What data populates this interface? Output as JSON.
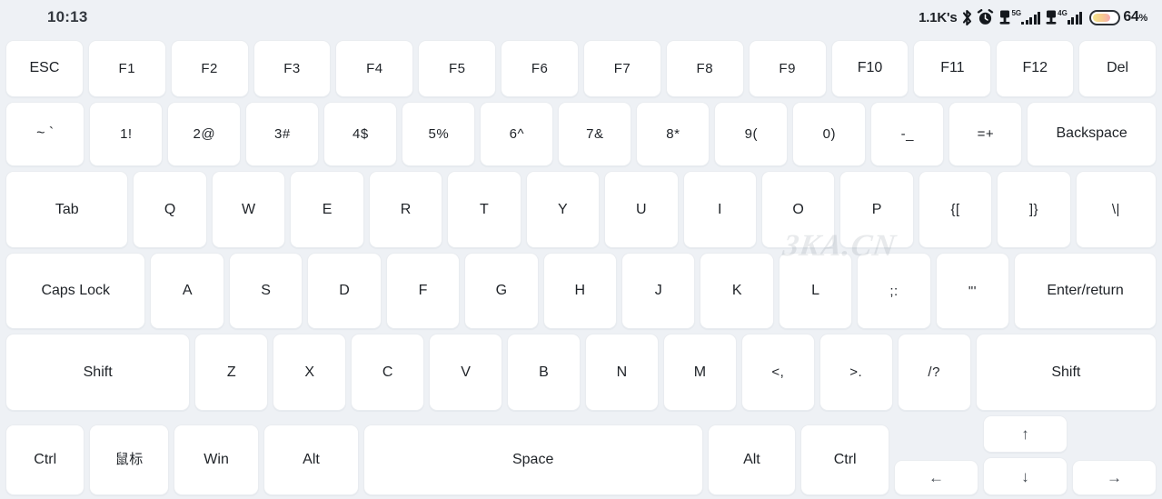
{
  "statusbar": {
    "time": "10:13",
    "network_speed": "1.1K's",
    "icons": [
      "bluetooth-icon",
      "alarm-clock-icon",
      "sim-card-icon",
      "sim-card-icon"
    ],
    "sim1_generation": "5G",
    "sim2_generation": "4G",
    "sim1_bars": 4,
    "sim2_bars": 4,
    "battery_percent": "64",
    "battery_percent_symbol": "%",
    "battery_level": 64
  },
  "watermark": "3KA.CN",
  "colors": {
    "background": "#eef1f5",
    "key_face": "#ffffff",
    "key_border": "#e9ecf0",
    "key_text": "#1e2227",
    "status_text": "#1b1f24",
    "battery_gradient_start": "#f3e48a",
    "battery_gradient_end": "#f4a9b3"
  },
  "keyboard": {
    "rows": [
      {
        "name": "function-row",
        "keys": [
          {
            "label": "ESC",
            "name": "key-esc",
            "flex": 1
          },
          {
            "label": "F1",
            "name": "key-f1",
            "flex": 1
          },
          {
            "label": "F2",
            "name": "key-f2",
            "flex": 1
          },
          {
            "label": "F3",
            "name": "key-f3",
            "flex": 1
          },
          {
            "label": "F4",
            "name": "key-f4",
            "flex": 1
          },
          {
            "label": "F5",
            "name": "key-f5",
            "flex": 1
          },
          {
            "label": "F6",
            "name": "key-f6",
            "flex": 1
          },
          {
            "label": "F7",
            "name": "key-f7",
            "flex": 1
          },
          {
            "label": "F8",
            "name": "key-f8",
            "flex": 1
          },
          {
            "label": "F9",
            "name": "key-f9",
            "flex": 1
          },
          {
            "label": "F10",
            "name": "key-f10",
            "flex": 1
          },
          {
            "label": "F11",
            "name": "key-f11",
            "flex": 1
          },
          {
            "label": "F12",
            "name": "key-f12",
            "flex": 1
          },
          {
            "label": "Del",
            "name": "key-del",
            "flex": 1
          }
        ]
      },
      {
        "name": "number-row",
        "keys": [
          {
            "label": "~ `",
            "name": "key-backtick",
            "flex": 1.08
          },
          {
            "label": "1!",
            "name": "key-1",
            "flex": 1
          },
          {
            "label": "2@",
            "name": "key-2",
            "flex": 1
          },
          {
            "label": "3#",
            "name": "key-3",
            "flex": 1
          },
          {
            "label": "4$",
            "name": "key-4",
            "flex": 1
          },
          {
            "label": "5%",
            "name": "key-5",
            "flex": 1
          },
          {
            "label": "6^",
            "name": "key-6",
            "flex": 1
          },
          {
            "label": "7&",
            "name": "key-7",
            "flex": 1
          },
          {
            "label": "8*",
            "name": "key-8",
            "flex": 1
          },
          {
            "label": "9(",
            "name": "key-9",
            "flex": 1
          },
          {
            "label": "0)",
            "name": "key-0",
            "flex": 1
          },
          {
            "label": "-_",
            "name": "key-minus",
            "flex": 1
          },
          {
            "label": "=+",
            "name": "key-equal",
            "flex": 1
          },
          {
            "label": "Backspace",
            "name": "key-backspace",
            "flex": 1.78
          }
        ]
      },
      {
        "name": "qwerty-row",
        "keys": [
          {
            "label": "Tab",
            "name": "key-tab",
            "flex": 1.68
          },
          {
            "label": "Q",
            "name": "key-q",
            "flex": 1
          },
          {
            "label": "W",
            "name": "key-w",
            "flex": 1
          },
          {
            "label": "E",
            "name": "key-e",
            "flex": 1
          },
          {
            "label": "R",
            "name": "key-r",
            "flex": 1
          },
          {
            "label": "T",
            "name": "key-t",
            "flex": 1
          },
          {
            "label": "Y",
            "name": "key-y",
            "flex": 1
          },
          {
            "label": "U",
            "name": "key-u",
            "flex": 1
          },
          {
            "label": "I",
            "name": "key-i",
            "flex": 1
          },
          {
            "label": "O",
            "name": "key-o",
            "flex": 1
          },
          {
            "label": "P",
            "name": "key-p",
            "flex": 1
          },
          {
            "label": "{[",
            "name": "key-bracket-left",
            "flex": 1
          },
          {
            "label": "]}",
            "name": "key-bracket-right",
            "flex": 1
          },
          {
            "label": "\\|",
            "name": "key-backslash",
            "flex": 1.1
          }
        ]
      },
      {
        "name": "home-row",
        "keys": [
          {
            "label": "Caps Lock",
            "name": "key-caps-lock",
            "flex": 1.92
          },
          {
            "label": "A",
            "name": "key-a",
            "flex": 1
          },
          {
            "label": "S",
            "name": "key-s",
            "flex": 1
          },
          {
            "label": "D",
            "name": "key-d",
            "flex": 1
          },
          {
            "label": "F",
            "name": "key-f",
            "flex": 1
          },
          {
            "label": "G",
            "name": "key-g",
            "flex": 1
          },
          {
            "label": "H",
            "name": "key-h",
            "flex": 1
          },
          {
            "label": "J",
            "name": "key-j",
            "flex": 1
          },
          {
            "label": "K",
            "name": "key-k",
            "flex": 1
          },
          {
            "label": "L",
            "name": "key-l",
            "flex": 1
          },
          {
            "label": ";:",
            "name": "key-semicolon",
            "flex": 1
          },
          {
            "label": "\"'",
            "name": "key-quote",
            "flex": 1
          },
          {
            "label": "Enter/return",
            "name": "key-enter",
            "flex": 1.95
          }
        ]
      },
      {
        "name": "shift-row",
        "keys": [
          {
            "label": "Shift",
            "name": "key-shift-left",
            "flex": 2.55
          },
          {
            "label": "Z",
            "name": "key-z",
            "flex": 1
          },
          {
            "label": "X",
            "name": "key-x",
            "flex": 1
          },
          {
            "label": "C",
            "name": "key-c",
            "flex": 1
          },
          {
            "label": "V",
            "name": "key-v",
            "flex": 1
          },
          {
            "label": "B",
            "name": "key-b",
            "flex": 1
          },
          {
            "label": "N",
            "name": "key-n",
            "flex": 1
          },
          {
            "label": "M",
            "name": "key-m",
            "flex": 1
          },
          {
            "label": "<,",
            "name": "key-comma",
            "flex": 1
          },
          {
            "label": ">.",
            "name": "key-period",
            "flex": 1
          },
          {
            "label": "/?",
            "name": "key-slash",
            "flex": 1
          },
          {
            "label": "Shift",
            "name": "key-shift-right",
            "flex": 2.5
          }
        ]
      },
      {
        "name": "bottom-row",
        "keys": [
          {
            "label": "Ctrl",
            "name": "key-ctrl-left",
            "flex": 1.0
          },
          {
            "label": "鼠标",
            "name": "key-mouse",
            "flex": 1.0
          },
          {
            "label": "Win",
            "name": "key-win",
            "flex": 1.08
          },
          {
            "label": "Alt",
            "name": "key-alt-left",
            "flex": 1.2
          },
          {
            "label": "Space",
            "name": "key-space",
            "flex": 4.35
          },
          {
            "label": "Alt",
            "name": "key-alt-right",
            "flex": 1.12
          },
          {
            "label": "Ctrl",
            "name": "key-ctrl-right",
            "flex": 1.12
          }
        ],
        "arrowpad": {
          "left": {
            "label": "←",
            "name": "key-arrow-left"
          },
          "up": {
            "label": "↑",
            "name": "key-arrow-up"
          },
          "down": {
            "label": "↓",
            "name": "key-arrow-down"
          },
          "right": {
            "label": "→",
            "name": "key-arrow-right"
          }
        }
      }
    ]
  }
}
